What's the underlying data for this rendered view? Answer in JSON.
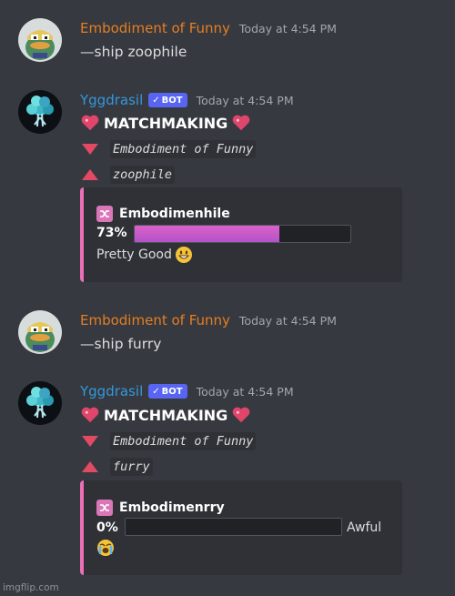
{
  "messages": [
    {
      "author": "Embodiment of Funny",
      "time": "Today at 4:54 PM",
      "text": "—ship zoophile"
    },
    {
      "author": "Yggdrasil",
      "bot_label": "BOT",
      "time": "Today at 4:54 PM",
      "title": "MATCHMAKING",
      "user1": "Embodiment of Funny",
      "user2": "zoophile",
      "embed": {
        "ship_name": "Embodimenhile",
        "percent": "73%",
        "progress": 73,
        "verdict": "Pretty Good"
      }
    },
    {
      "author": "Embodiment of Funny",
      "time": "Today at 4:54 PM",
      "text": "—ship furry"
    },
    {
      "author": "Yggdrasil",
      "bot_label": "BOT",
      "time": "Today at 4:54 PM",
      "title": "MATCHMAKING",
      "user1": "Embodiment of Funny",
      "user2": "furry",
      "embed": {
        "ship_name": "Embodimenrry",
        "percent": "0%",
        "progress": 0,
        "verdict": "Awful"
      }
    }
  ],
  "colors": {
    "funny_name": "#e67e22",
    "bot_name": "#3498db",
    "embed_border": "#e96fb6",
    "arrow": "#e24a64",
    "bar_fill": "#c65bc8"
  },
  "icons": {
    "heart": "sparkling-heart-icon",
    "down": "red-down-triangle-icon",
    "up": "red-up-triangle-icon",
    "shuffle": "shuffle-icon",
    "happy": "grinning-face-icon",
    "sad": "loudly-crying-face-icon"
  },
  "watermark": "imgflip.com"
}
